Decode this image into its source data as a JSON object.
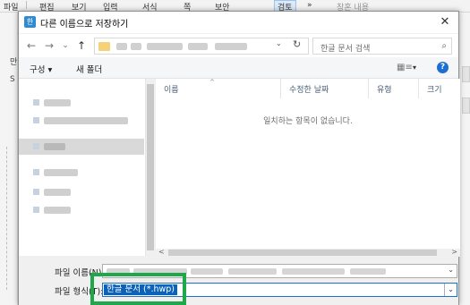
{
  "app": {
    "menu": [
      "파일",
      "편집",
      "보기",
      "입력",
      "서식",
      "쪽",
      "보안",
      "검토",
      "»",
      "창혼 내용"
    ],
    "left_chars": [
      "만",
      "S"
    ]
  },
  "dialog": {
    "title": "다른 이름으로 저장하기",
    "close": "✕",
    "nav": {
      "back": "←",
      "forward": "→",
      "dropdown": "⌄",
      "up": "↑",
      "address_dropdown": "⌄",
      "refresh": "↻"
    },
    "search": {
      "placeholder": "한글 문서 검색",
      "icon": "⌕"
    },
    "toolbar": {
      "organize": "구성 ▾",
      "new_folder": "새 폴더",
      "view_icon": "▦≡",
      "view_dropdown": "▾",
      "help": "?"
    },
    "columns": [
      "이름",
      "수정한 날짜",
      "유형",
      "크기"
    ],
    "sort_arrow": "^",
    "empty_message": "일치하는 항목이 없습니다.",
    "scroll": {
      "left": "<",
      "right": ">"
    },
    "filename_label": "파일 이름(N):",
    "filetype_label": "파일 형식(T):",
    "filetype_value": "한글 문서 (*.hwp)",
    "dropdown_glyph": "⌄"
  },
  "colors": {
    "highlight": "#1fa84a",
    "selection": "#0b62b6"
  }
}
